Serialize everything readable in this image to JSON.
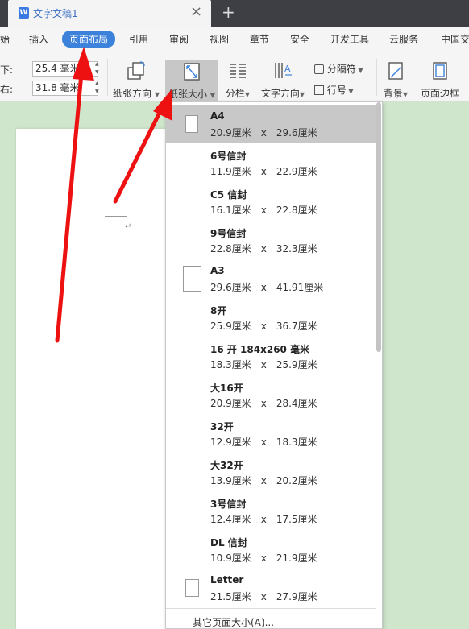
{
  "tab": {
    "title": "文字文稿1",
    "app_icon": "W",
    "close": "×",
    "new_tab": "+"
  },
  "menu": [
    "始",
    "插入",
    "页面布局",
    "引用",
    "审阅",
    "视图",
    "章节",
    "安全",
    "开发工具",
    "云服务",
    "中国交"
  ],
  "menu_active": "页面布局",
  "margins": {
    "bottom_label": "下:",
    "bottom_value": "25.4 毫米",
    "right_label": "右:",
    "right_value": "31.8 毫米"
  },
  "ribbon": {
    "orientation": "纸张方向",
    "size": "纸张大小",
    "columns": "分栏",
    "text_direction": "文字方向",
    "separator": "分隔符",
    "line_numbers": "行号",
    "background": "背景",
    "page_border": "页面边框"
  },
  "paper_sizes": [
    {
      "name": "A4",
      "w": "20.9厘米",
      "h": "29.6厘米",
      "selected": true
    },
    {
      "name": "6号信封",
      "w": "11.9厘米",
      "h": "22.9厘米"
    },
    {
      "name": "C5 信封",
      "w": "16.1厘米",
      "h": "22.8厘米"
    },
    {
      "name": "9号信封",
      "w": "22.8厘米",
      "h": "32.3厘米"
    },
    {
      "name": "A3",
      "w": "29.6厘米",
      "h": "41.91厘米"
    },
    {
      "name": "8开",
      "w": "25.9厘米",
      "h": "36.7厘米"
    },
    {
      "name": "16 开 184x260 毫米",
      "w": "18.3厘米",
      "h": "25.9厘米"
    },
    {
      "name": "大16开",
      "w": "20.9厘米",
      "h": "28.4厘米"
    },
    {
      "name": "32开",
      "w": "12.9厘米",
      "h": "18.3厘米"
    },
    {
      "name": "大32开",
      "w": "13.9厘米",
      "h": "20.2厘米"
    },
    {
      "name": "3号信封",
      "w": "12.4厘米",
      "h": "17.5厘米"
    },
    {
      "name": "DL 信封",
      "w": "10.9厘米",
      "h": "21.9厘米"
    },
    {
      "name": "Letter",
      "w": "21.5厘米",
      "h": "27.9厘米"
    }
  ],
  "dims_separator": "x",
  "footer": "其它页面大小(A)...",
  "colors": {
    "accent": "#3d82da",
    "arrow": "#ee1111",
    "page_bg": "#cfe6cc",
    "titlebar": "#3d3f44"
  }
}
